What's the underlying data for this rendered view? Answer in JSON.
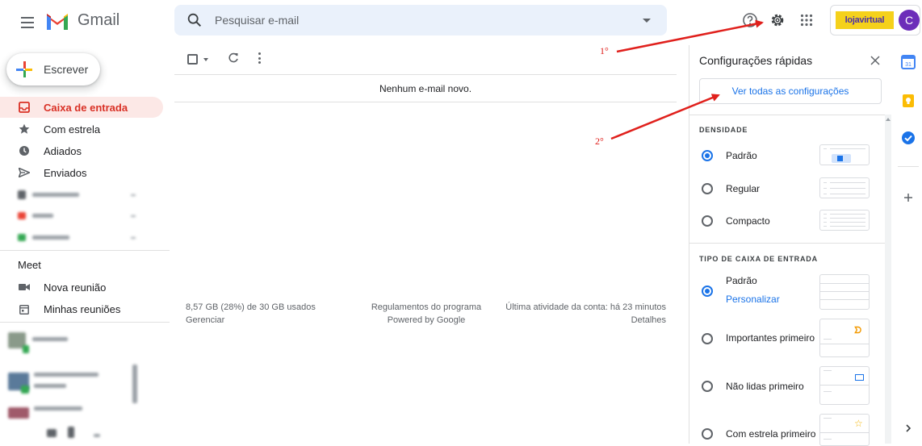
{
  "header": {
    "app_name": "Gmail",
    "search_placeholder": "Pesquisar e-mail",
    "account_brand": "lojavirtual",
    "avatar_initial": "C"
  },
  "compose": {
    "label": "Escrever"
  },
  "nav": [
    {
      "label": "Caixa de entrada",
      "icon": "inbox-icon",
      "active": true
    },
    {
      "label": "Com estrela",
      "icon": "star-icon",
      "active": false
    },
    {
      "label": "Adiados",
      "icon": "clock-icon",
      "active": false
    },
    {
      "label": "Enviados",
      "icon": "send-icon",
      "active": false
    }
  ],
  "meet": {
    "title": "Meet",
    "items": [
      {
        "label": "Nova reunião",
        "icon": "video-icon"
      },
      {
        "label": "Minhas reuniões",
        "icon": "calendar-icon"
      }
    ]
  },
  "main": {
    "empty_message": "Nenhum e-mail novo.",
    "footer": {
      "storage": "8,57 GB (28%) de 30 GB usados",
      "manage": "Gerenciar",
      "policies": "Regulamentos do programa",
      "powered": "Powered by Google",
      "last_activity": "Última atividade da conta: há 23 minutos",
      "details": "Detalhes"
    }
  },
  "quick_settings": {
    "title": "Configurações rápidas",
    "see_all": "Ver todas as configurações",
    "density": {
      "heading": "DENSIDADE",
      "options": [
        {
          "label": "Padrão",
          "checked": true
        },
        {
          "label": "Regular",
          "checked": false
        },
        {
          "label": "Compacto",
          "checked": false
        }
      ]
    },
    "inbox_type": {
      "heading": "TIPO DE CAIXA DE ENTRADA",
      "options": [
        {
          "label": "Padrão",
          "checked": true,
          "link": "Personalizar"
        },
        {
          "label": "Importantes primeiro",
          "checked": false
        },
        {
          "label": "Não lidas primeiro",
          "checked": false
        },
        {
          "label": "Com estrela primeiro",
          "checked": false
        }
      ]
    }
  },
  "annotations": {
    "step1": "1°",
    "step2": "2°"
  },
  "colors": {
    "accent_red": "#d93025",
    "link_blue": "#1a73e8",
    "annotation_red": "#e0201c"
  }
}
